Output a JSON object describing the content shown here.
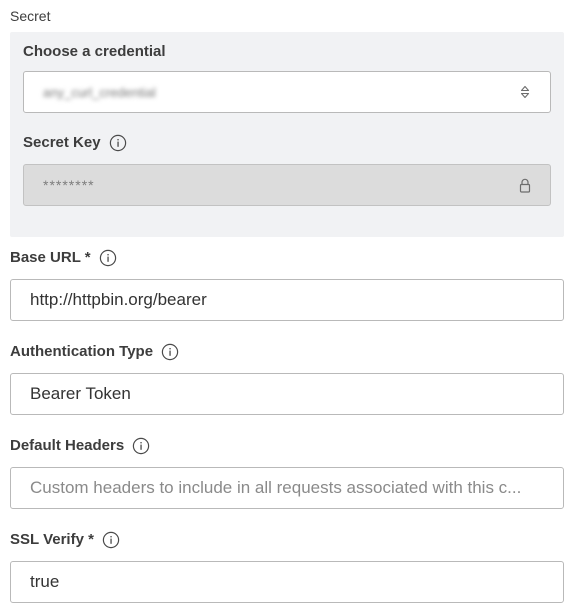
{
  "secret": {
    "section_label": "Secret",
    "credential": {
      "label": "Choose a credential",
      "selected_value": "any_curl_credential"
    },
    "secret_key": {
      "label": "Secret Key",
      "masked_value": "********"
    }
  },
  "fields": {
    "base_url": {
      "label": "Base URL *",
      "value": "http://httpbin.org/bearer"
    },
    "auth_type": {
      "label": "Authentication Type",
      "value": "Bearer Token"
    },
    "default_headers": {
      "label": "Default Headers",
      "placeholder": "Custom headers to include in all requests associated with this c..."
    },
    "ssl_verify": {
      "label": "SSL Verify *",
      "value": "true"
    }
  },
  "icons": {
    "info": "info-circle-icon",
    "select": "chevron-up-down-icon",
    "lock": "lock-icon"
  },
  "colors": {
    "panel_bg": "#f1f2f4",
    "disabled_bg": "#dcdcdc",
    "border": "#b9b9b9",
    "text": "#333333"
  }
}
